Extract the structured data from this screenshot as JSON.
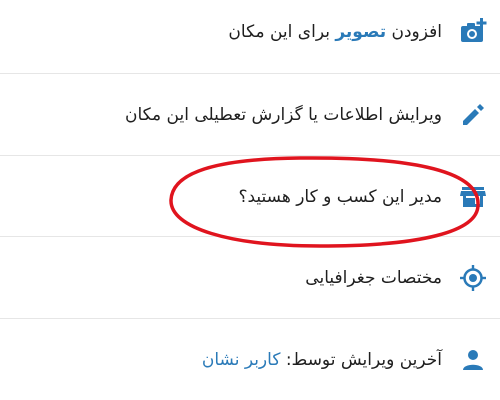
{
  "colors": {
    "icon": "#2a7ab8",
    "link": "#2a7ab8",
    "text": "#1f1f1f",
    "divider": "#e6e6e6",
    "annotation": "#e0141e"
  },
  "items": [
    {
      "id": "add-photo",
      "icon": "add-photo-icon",
      "label_prefix": "افزودن ",
      "label_highlight": "تصویر",
      "label_suffix": " برای این مکان"
    },
    {
      "id": "edit-info",
      "icon": "pencil-icon",
      "label": "ویرایش اطلاعات یا گزارش تعطیلی این مکان"
    },
    {
      "id": "business-owner",
      "icon": "store-icon",
      "label": "مدیر این کسب و کار هستید؟"
    },
    {
      "id": "coordinates",
      "icon": "gps-target-icon",
      "label": "مختصات جغرافیایی"
    },
    {
      "id": "last-edit",
      "icon": "person-icon",
      "label_prefix": "آخرین ویرایش توسط: ",
      "label_link": "کاربر نشان"
    }
  ]
}
